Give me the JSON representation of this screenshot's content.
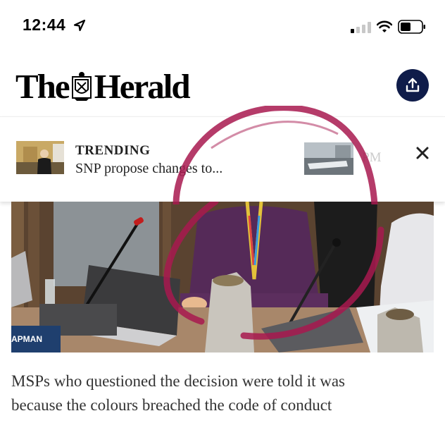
{
  "status_bar": {
    "time": "12:44"
  },
  "header": {
    "logo_left": "The",
    "logo_right": "Herald"
  },
  "trending": {
    "label": "TRENDING",
    "title": "SNP propose changes to...",
    "next_title": "PM"
  },
  "photo": {
    "nameplate": "APMAN"
  },
  "article": {
    "line1": "MSPs who questioned the decision were told it was",
    "line2": "because the colours breached the code of conduct"
  },
  "colors": {
    "share_button": "#0f1c4a",
    "annotation_circle": "#a8194f"
  },
  "icons": [
    "location-arrow-icon",
    "signal-icon",
    "wifi-icon",
    "battery-icon",
    "share-icon",
    "close-icon"
  ]
}
